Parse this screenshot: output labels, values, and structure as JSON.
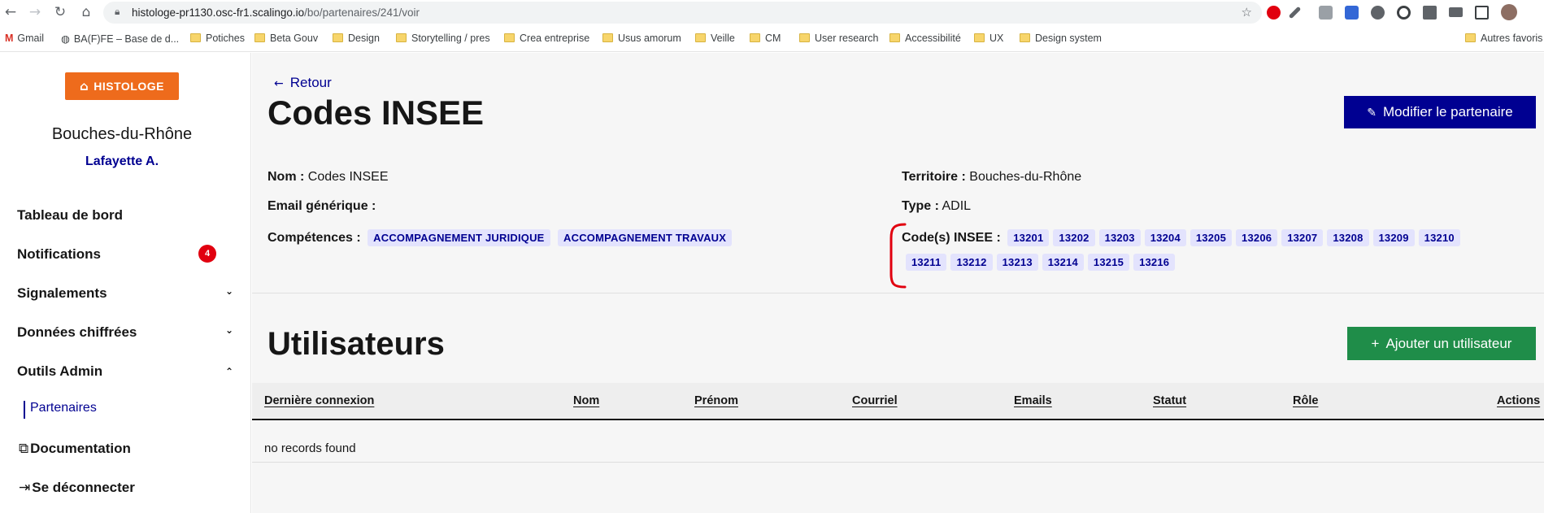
{
  "browser": {
    "url_host": "histologe-pr1130.osc-fr1.scalingo.io",
    "url_path": "/bo/partenaires/241/voir",
    "bookmarks": [
      "Gmail",
      "BA(F)FE – Base de d...",
      "Potiches",
      "Beta Gouv",
      "Design",
      "Storytelling / pres",
      "Crea entreprise",
      "Usus amorum",
      "Veille",
      "CM",
      "User research",
      "Accessibilité",
      "UX",
      "Design system",
      "Autres favoris"
    ]
  },
  "sidebar": {
    "logo_text": "HISTOLOGE",
    "department": "Bouches-du-Rhône",
    "user_name": "Lafayette A.",
    "items": [
      {
        "label": "Tableau de bord"
      },
      {
        "label": "Notifications",
        "badge": "4"
      },
      {
        "label": "Signalements"
      },
      {
        "label": "Données chiffrées"
      },
      {
        "label": "Outils Admin"
      }
    ],
    "sub_item": "Partenaires",
    "documentation": "Documentation",
    "logout": "Se déconnecter"
  },
  "main": {
    "back_label": "Retour",
    "title": "Codes INSEE",
    "edit_button": "Modifier le partenaire",
    "fields": {
      "nom_label": "Nom :",
      "nom_value": "Codes INSEE",
      "email_label": "Email générique :",
      "competences_label": "Compétences :",
      "competences": [
        "ACCOMPAGNEMENT JURIDIQUE",
        "ACCOMPAGNEMENT TRAVAUX"
      ],
      "territoire_label": "Territoire :",
      "territoire_value": "Bouches-du-Rhône",
      "type_label": "Type :",
      "type_value": "ADIL",
      "codes_label": "Code(s) INSEE :",
      "codes": [
        "13201",
        "13202",
        "13203",
        "13204",
        "13205",
        "13206",
        "13207",
        "13208",
        "13209",
        "13210",
        "13211",
        "13212",
        "13213",
        "13214",
        "13215",
        "13216"
      ]
    },
    "users_title": "Utilisateurs",
    "add_user_button": "Ajouter un utilisateur",
    "table": {
      "columns": [
        "Dernière connexion",
        "Nom",
        "Prénom",
        "Courriel",
        "Emails",
        "Statut",
        "Rôle",
        "Actions"
      ],
      "empty_message": "no records found"
    }
  },
  "colors": {
    "primary": "#000091",
    "success": "#1f8d49",
    "brand_orange": "#ee6b1c",
    "badge_red": "#e1000f",
    "annotation_red": "#e1000f"
  }
}
